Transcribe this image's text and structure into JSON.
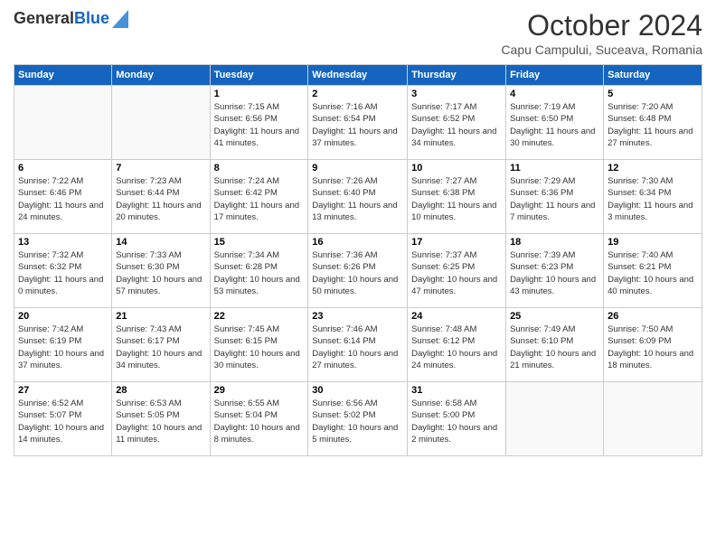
{
  "header": {
    "logo_line1": "General",
    "logo_line2": "Blue",
    "month": "October 2024",
    "location": "Capu Campului, Suceava, Romania"
  },
  "days_of_week": [
    "Sunday",
    "Monday",
    "Tuesday",
    "Wednesday",
    "Thursday",
    "Friday",
    "Saturday"
  ],
  "weeks": [
    [
      {
        "day": "",
        "detail": ""
      },
      {
        "day": "",
        "detail": ""
      },
      {
        "day": "1",
        "detail": "Sunrise: 7:15 AM\nSunset: 6:56 PM\nDaylight: 11 hours and 41 minutes."
      },
      {
        "day": "2",
        "detail": "Sunrise: 7:16 AM\nSunset: 6:54 PM\nDaylight: 11 hours and 37 minutes."
      },
      {
        "day": "3",
        "detail": "Sunrise: 7:17 AM\nSunset: 6:52 PM\nDaylight: 11 hours and 34 minutes."
      },
      {
        "day": "4",
        "detail": "Sunrise: 7:19 AM\nSunset: 6:50 PM\nDaylight: 11 hours and 30 minutes."
      },
      {
        "day": "5",
        "detail": "Sunrise: 7:20 AM\nSunset: 6:48 PM\nDaylight: 11 hours and 27 minutes."
      }
    ],
    [
      {
        "day": "6",
        "detail": "Sunrise: 7:22 AM\nSunset: 6:46 PM\nDaylight: 11 hours and 24 minutes."
      },
      {
        "day": "7",
        "detail": "Sunrise: 7:23 AM\nSunset: 6:44 PM\nDaylight: 11 hours and 20 minutes."
      },
      {
        "day": "8",
        "detail": "Sunrise: 7:24 AM\nSunset: 6:42 PM\nDaylight: 11 hours and 17 minutes."
      },
      {
        "day": "9",
        "detail": "Sunrise: 7:26 AM\nSunset: 6:40 PM\nDaylight: 11 hours and 13 minutes."
      },
      {
        "day": "10",
        "detail": "Sunrise: 7:27 AM\nSunset: 6:38 PM\nDaylight: 11 hours and 10 minutes."
      },
      {
        "day": "11",
        "detail": "Sunrise: 7:29 AM\nSunset: 6:36 PM\nDaylight: 11 hours and 7 minutes."
      },
      {
        "day": "12",
        "detail": "Sunrise: 7:30 AM\nSunset: 6:34 PM\nDaylight: 11 hours and 3 minutes."
      }
    ],
    [
      {
        "day": "13",
        "detail": "Sunrise: 7:32 AM\nSunset: 6:32 PM\nDaylight: 11 hours and 0 minutes."
      },
      {
        "day": "14",
        "detail": "Sunrise: 7:33 AM\nSunset: 6:30 PM\nDaylight: 10 hours and 57 minutes."
      },
      {
        "day": "15",
        "detail": "Sunrise: 7:34 AM\nSunset: 6:28 PM\nDaylight: 10 hours and 53 minutes."
      },
      {
        "day": "16",
        "detail": "Sunrise: 7:36 AM\nSunset: 6:26 PM\nDaylight: 10 hours and 50 minutes."
      },
      {
        "day": "17",
        "detail": "Sunrise: 7:37 AM\nSunset: 6:25 PM\nDaylight: 10 hours and 47 minutes."
      },
      {
        "day": "18",
        "detail": "Sunrise: 7:39 AM\nSunset: 6:23 PM\nDaylight: 10 hours and 43 minutes."
      },
      {
        "day": "19",
        "detail": "Sunrise: 7:40 AM\nSunset: 6:21 PM\nDaylight: 10 hours and 40 minutes."
      }
    ],
    [
      {
        "day": "20",
        "detail": "Sunrise: 7:42 AM\nSunset: 6:19 PM\nDaylight: 10 hours and 37 minutes."
      },
      {
        "day": "21",
        "detail": "Sunrise: 7:43 AM\nSunset: 6:17 PM\nDaylight: 10 hours and 34 minutes."
      },
      {
        "day": "22",
        "detail": "Sunrise: 7:45 AM\nSunset: 6:15 PM\nDaylight: 10 hours and 30 minutes."
      },
      {
        "day": "23",
        "detail": "Sunrise: 7:46 AM\nSunset: 6:14 PM\nDaylight: 10 hours and 27 minutes."
      },
      {
        "day": "24",
        "detail": "Sunrise: 7:48 AM\nSunset: 6:12 PM\nDaylight: 10 hours and 24 minutes."
      },
      {
        "day": "25",
        "detail": "Sunrise: 7:49 AM\nSunset: 6:10 PM\nDaylight: 10 hours and 21 minutes."
      },
      {
        "day": "26",
        "detail": "Sunrise: 7:50 AM\nSunset: 6:09 PM\nDaylight: 10 hours and 18 minutes."
      }
    ],
    [
      {
        "day": "27",
        "detail": "Sunrise: 6:52 AM\nSunset: 5:07 PM\nDaylight: 10 hours and 14 minutes."
      },
      {
        "day": "28",
        "detail": "Sunrise: 6:53 AM\nSunset: 5:05 PM\nDaylight: 10 hours and 11 minutes."
      },
      {
        "day": "29",
        "detail": "Sunrise: 6:55 AM\nSunset: 5:04 PM\nDaylight: 10 hours and 8 minutes."
      },
      {
        "day": "30",
        "detail": "Sunrise: 6:56 AM\nSunset: 5:02 PM\nDaylight: 10 hours and 5 minutes."
      },
      {
        "day": "31",
        "detail": "Sunrise: 6:58 AM\nSunset: 5:00 PM\nDaylight: 10 hours and 2 minutes."
      },
      {
        "day": "",
        "detail": ""
      },
      {
        "day": "",
        "detail": ""
      }
    ]
  ]
}
